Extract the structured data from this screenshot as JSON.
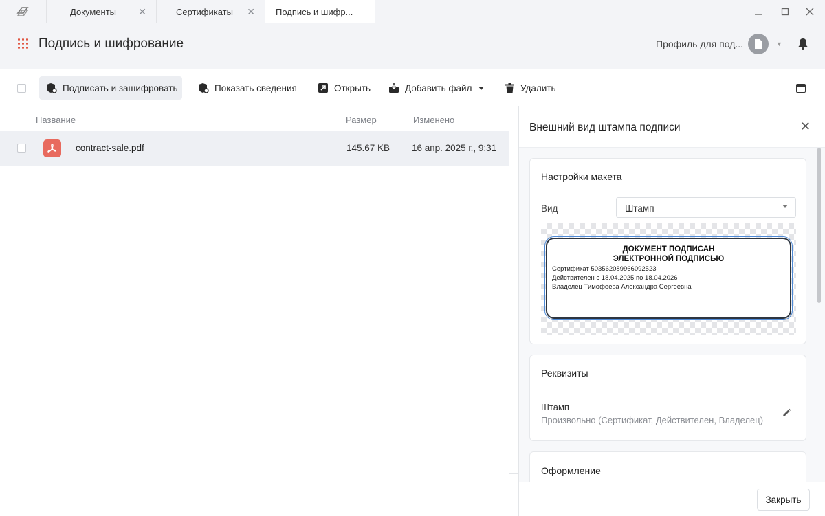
{
  "tabs": [
    {
      "label": "Документы",
      "active": false
    },
    {
      "label": "Сертификаты",
      "active": false
    },
    {
      "label": "Подпись и шифр...",
      "active": true
    }
  ],
  "header": {
    "title": "Подпись и шифрование",
    "profile_label": "Профиль для под..."
  },
  "toolbar": {
    "sign_encrypt": "Подписать и зашифровать",
    "show_details": "Показать сведения",
    "open": "Открыть",
    "add_file": "Добавить файл",
    "delete": "Удалить"
  },
  "filelist": {
    "columns": {
      "name": "Название",
      "size": "Размер",
      "modified": "Изменено"
    },
    "rows": [
      {
        "name": "contract-sale.pdf",
        "size": "145.67 KB",
        "modified": "16 апр. 2025 г., 9:31"
      }
    ]
  },
  "panel": {
    "title": "Внешний вид штампа подписи",
    "layout_settings": {
      "title": "Настройки макета",
      "view_label": "Вид",
      "view_value": "Штамп"
    },
    "stamp": {
      "title_line1": "ДОКУМЕНТ ПОДПИСАН",
      "title_line2": "ЭЛЕКТРОННОЙ ПОДПИСЬЮ",
      "certificate": "Сертификат 503562089966092523",
      "valid": "Действителен с 18.04.2025 по 18.04.2026",
      "owner": "Владелец Тимофеева Александра Сергеевна"
    },
    "requisites": {
      "title": "Реквизиты",
      "item_name": "Штамп",
      "item_desc": "Произвольно (Сертификат, Действителен, Владелец)"
    },
    "design": {
      "title": "Оформление"
    },
    "close_button": "Закрыть"
  },
  "colors": {
    "accent": "#e0503c",
    "pdf": "#e86a5e",
    "stamp_border": "#2d3540",
    "selection_outline": "#4f8ad6"
  }
}
